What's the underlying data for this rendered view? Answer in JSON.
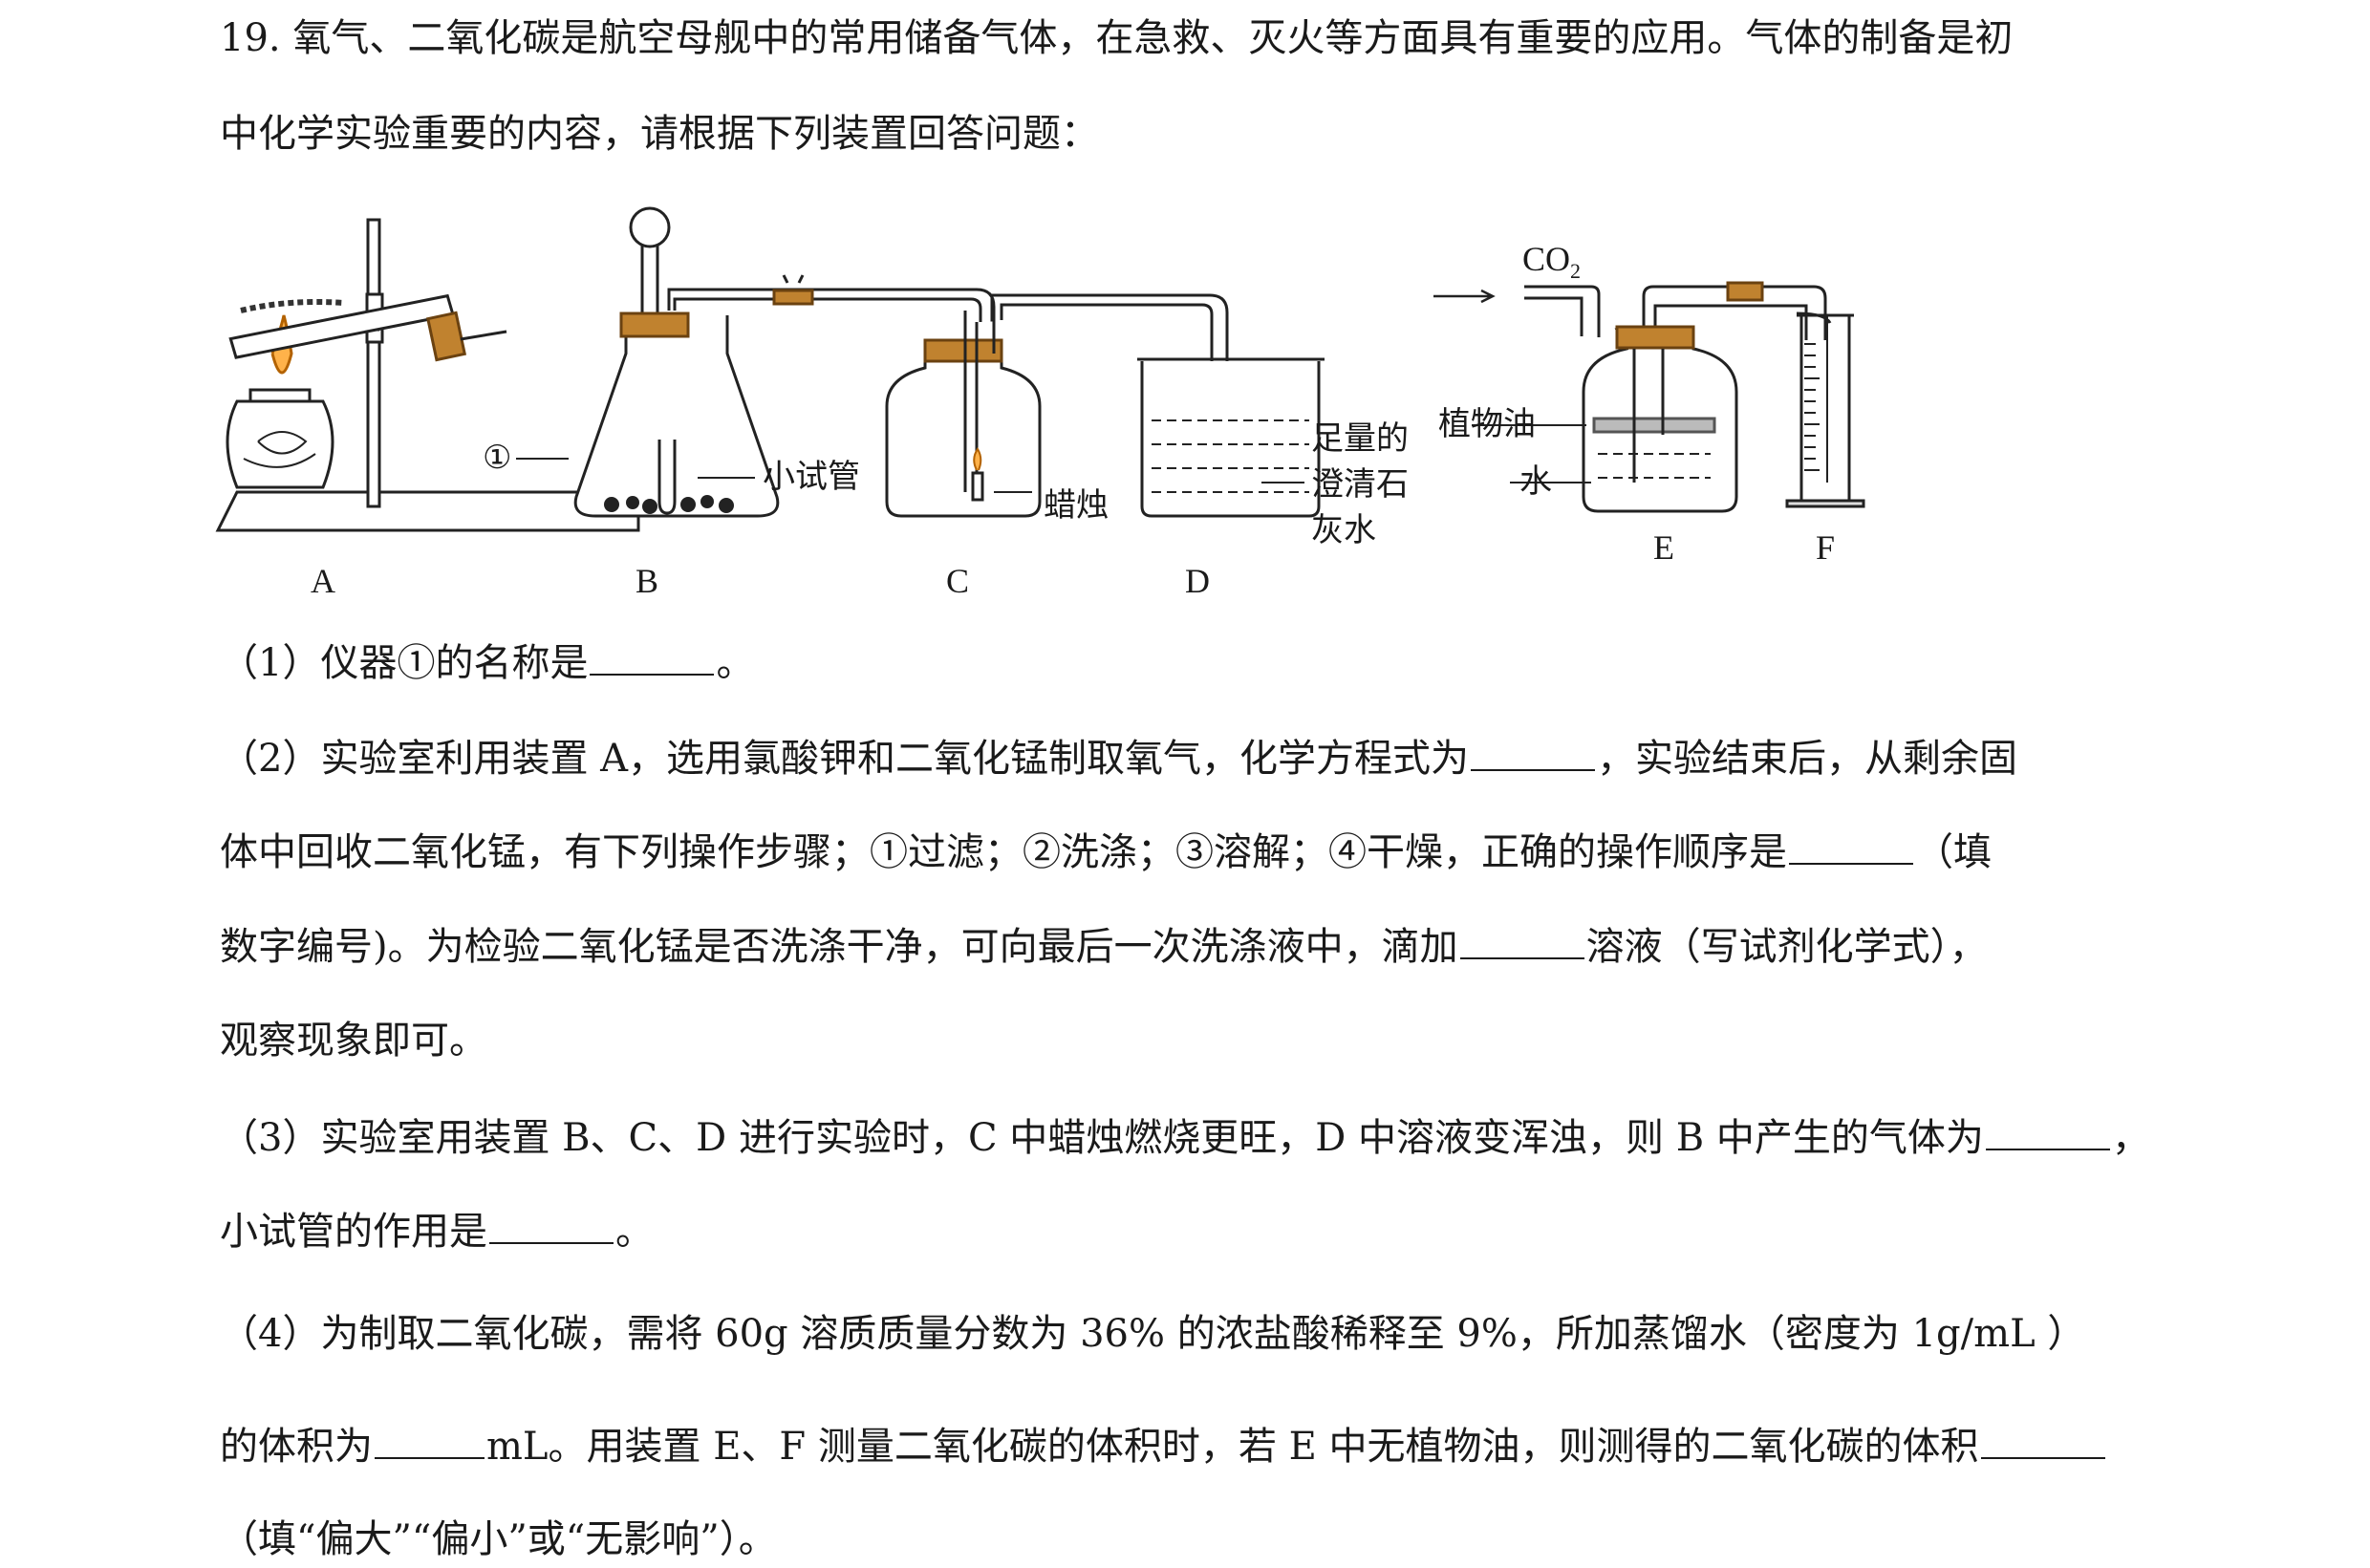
{
  "question": {
    "intro_line1": "19. 氧气、二氧化碳是航空母舰中的常用储备气体，在急救、灭火等方面具有重要的应用。气体的制备是初",
    "intro_line2": "中化学实验重要的内容，请根据下列装置回答问题：",
    "q1": {
      "text": "（1）仪器①的名称是",
      "tail": "。"
    },
    "q2": {
      "l1a": "（2）实验室利用装置 A，选用氯酸钾和二氧化锰制取氧气，化学方程式为",
      "l1b": "，实验结束后，从剩余固",
      "l2a": "体中回收二氧化锰，有下列操作步骤；①过滤；②洗涤；③溶解；④干燥，正确的操作顺序是",
      "l2b": "（填",
      "l3a": "数字编号)。为检验二氧化锰是否洗涤干净，可向最后一次洗涤液中，滴加",
      "l3b": "溶液（写试剂化学式），",
      "l4": "观察现象即可。"
    },
    "q3": {
      "l1a": "（3）实验室用装置 B、C、D 进行实验时，C 中蜡烛燃烧更旺，D 中溶液变浑浊，则 B 中产生的气体为",
      "l1b": "，",
      "l2a": "小试管的作用是",
      "l2b": "。"
    },
    "q4": {
      "l1": "（4）为制取二氧化碳，需将 60g 溶质质量分数为 36% 的浓盐酸稀释至 9%，所加蒸馏水（密度为 1g/mL ）",
      "l2a": "的体积为",
      "l2b": "mL。用装置 E、F 测量二氧化碳的体积时，若 E 中无植物油，则测得的二氧化碳的体积",
      "l3": "（填“偏大”“偏小”或“无影响”）。"
    }
  },
  "figure": {
    "labels": {
      "A": "A",
      "B": "B",
      "C": "C",
      "D": "D",
      "E": "E",
      "F": "F"
    },
    "marker_1": "①",
    "small_tube": "小试管",
    "candle": "蜡烛",
    "limewater_1": "足量的",
    "limewater_2": "澄清石",
    "limewater_3": "灰水",
    "co2": "CO",
    "co2_sub": "2",
    "veg_oil": "植物油",
    "water": "水"
  }
}
